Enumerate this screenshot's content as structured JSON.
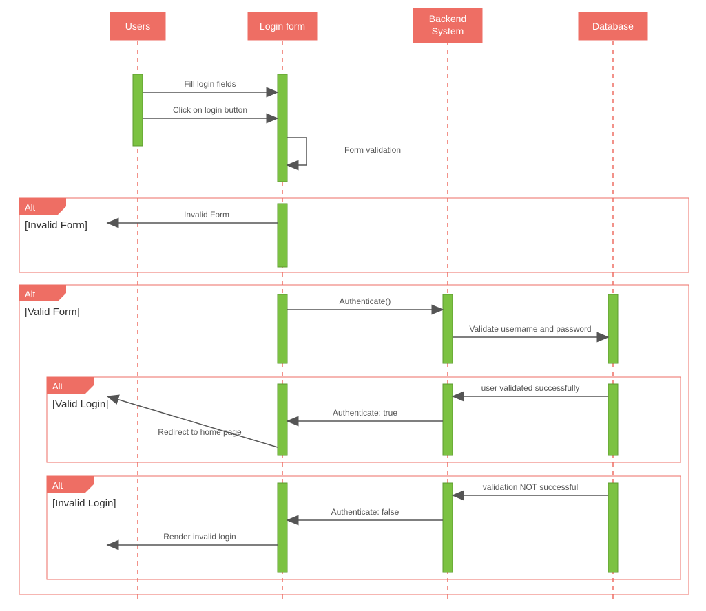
{
  "actors": {
    "users": "Users",
    "login": "Login form",
    "backend": "Backend\nSystem",
    "db": "Database"
  },
  "msgs": {
    "fill": "Fill login fields",
    "click": "Click on login button",
    "formval": "Form validation",
    "invalid": "Invalid Form",
    "auth": "Authenticate()",
    "validup": "Validate username and password",
    "okval": "user validated successfully",
    "authtrue": "Authenticate: true",
    "redirect": "Redirect to home page",
    "badval": "validation NOT successful",
    "authfalse": "Authenticate: false",
    "render": "Render invalid login"
  },
  "alt": {
    "label": "Alt",
    "invalidform": "[Invalid Form]",
    "validform": "[Valid Form]",
    "validlogin": "[Valid Login]",
    "invalidlogin": "[Invalid Login]"
  }
}
